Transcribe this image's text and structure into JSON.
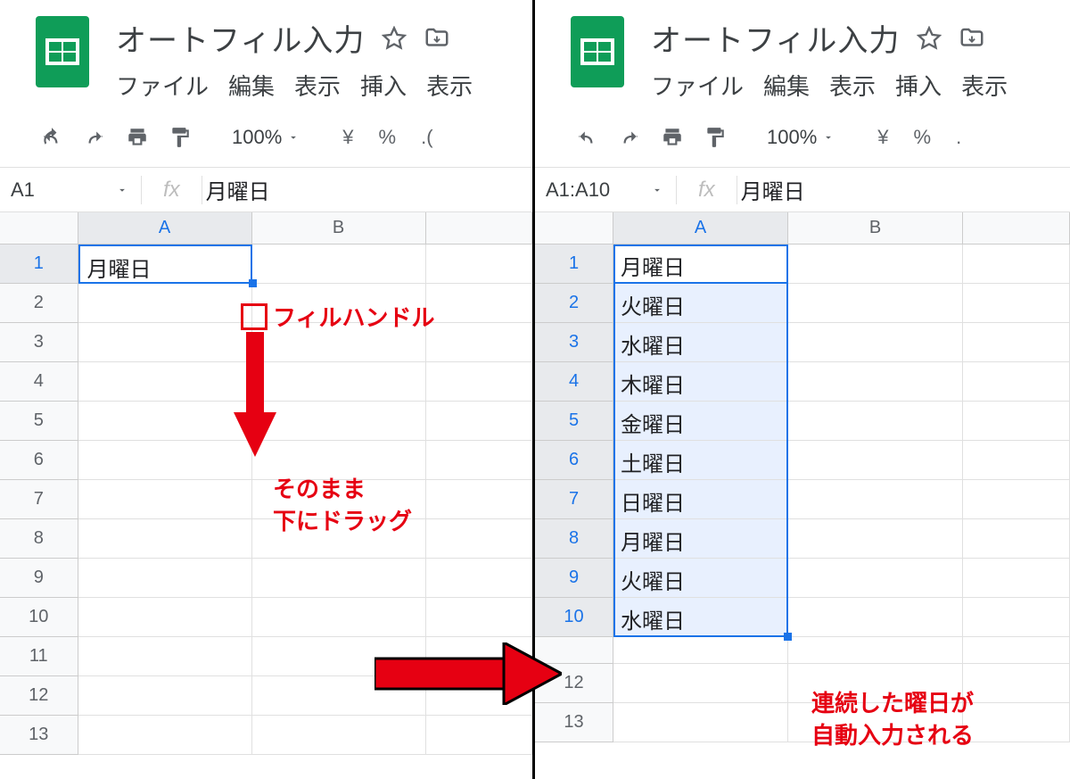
{
  "left": {
    "title": "オートフィル入力",
    "menus": [
      "ファイル",
      "編集",
      "表示",
      "挿入",
      "表示"
    ],
    "zoom": "100%",
    "currency": "¥",
    "percent": "%",
    "decimal": ".(",
    "name_box": "A1",
    "fx": "fx",
    "formula_value": "月曜日",
    "col_headers": [
      "A",
      "B"
    ],
    "row_numbers": [
      "1",
      "2",
      "3",
      "4",
      "5",
      "6",
      "7",
      "8",
      "9",
      "10",
      "11",
      "12",
      "13"
    ],
    "cells": {
      "A1": "月曜日"
    },
    "annotations": {
      "fill_handle_label": "フィルハンドル",
      "drag_label_line1": "そのまま",
      "drag_label_line2": "下にドラッグ"
    }
  },
  "right": {
    "title": "オートフィル入力",
    "menus": [
      "ファイル",
      "編集",
      "表示",
      "挿入",
      "表示"
    ],
    "zoom": "100%",
    "currency": "¥",
    "percent": "%",
    "decimal": ".",
    "name_box": "A1:A10",
    "fx": "fx",
    "formula_value": "月曜日",
    "col_headers": [
      "A",
      "B"
    ],
    "row_numbers": [
      "1",
      "2",
      "3",
      "4",
      "5",
      "6",
      "7",
      "8",
      "9",
      "10",
      "",
      "12",
      "13"
    ],
    "cells": {
      "A1": "月曜日",
      "A2": "火曜日",
      "A3": "水曜日",
      "A4": "木曜日",
      "A5": "金曜日",
      "A6": "土曜日",
      "A7": "日曜日",
      "A8": "月曜日",
      "A9": "火曜日",
      "A10": "水曜日"
    },
    "annotations": {
      "result_label_line1": "連続した曜日が",
      "result_label_line2": "自動入力される"
    }
  }
}
